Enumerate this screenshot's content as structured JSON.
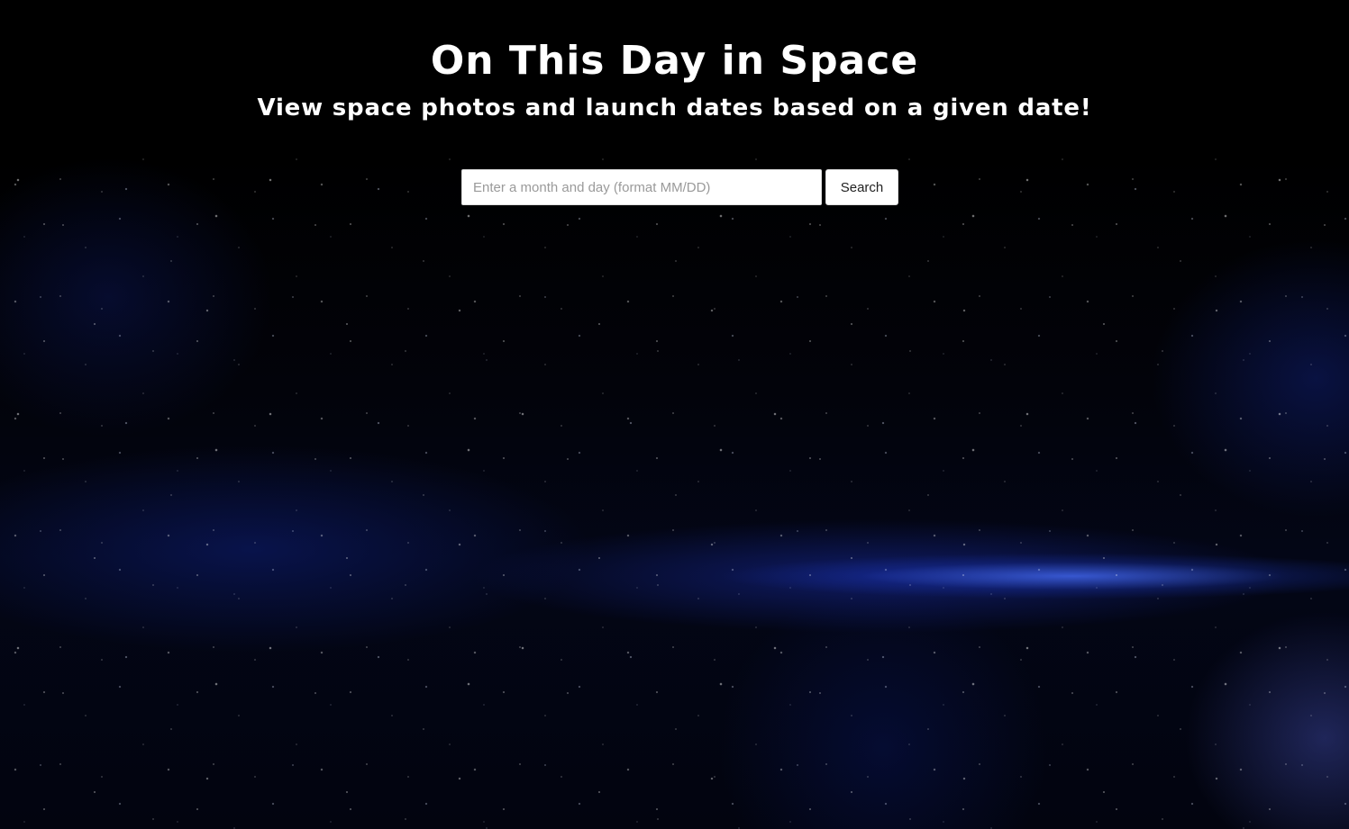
{
  "header": {
    "title": "On This Day in Space",
    "subtitle": "View space photos and launch dates based on a given date!"
  },
  "search": {
    "value": "",
    "placeholder": "Enter a month and day (format MM/DD)",
    "button_label": "Search"
  }
}
